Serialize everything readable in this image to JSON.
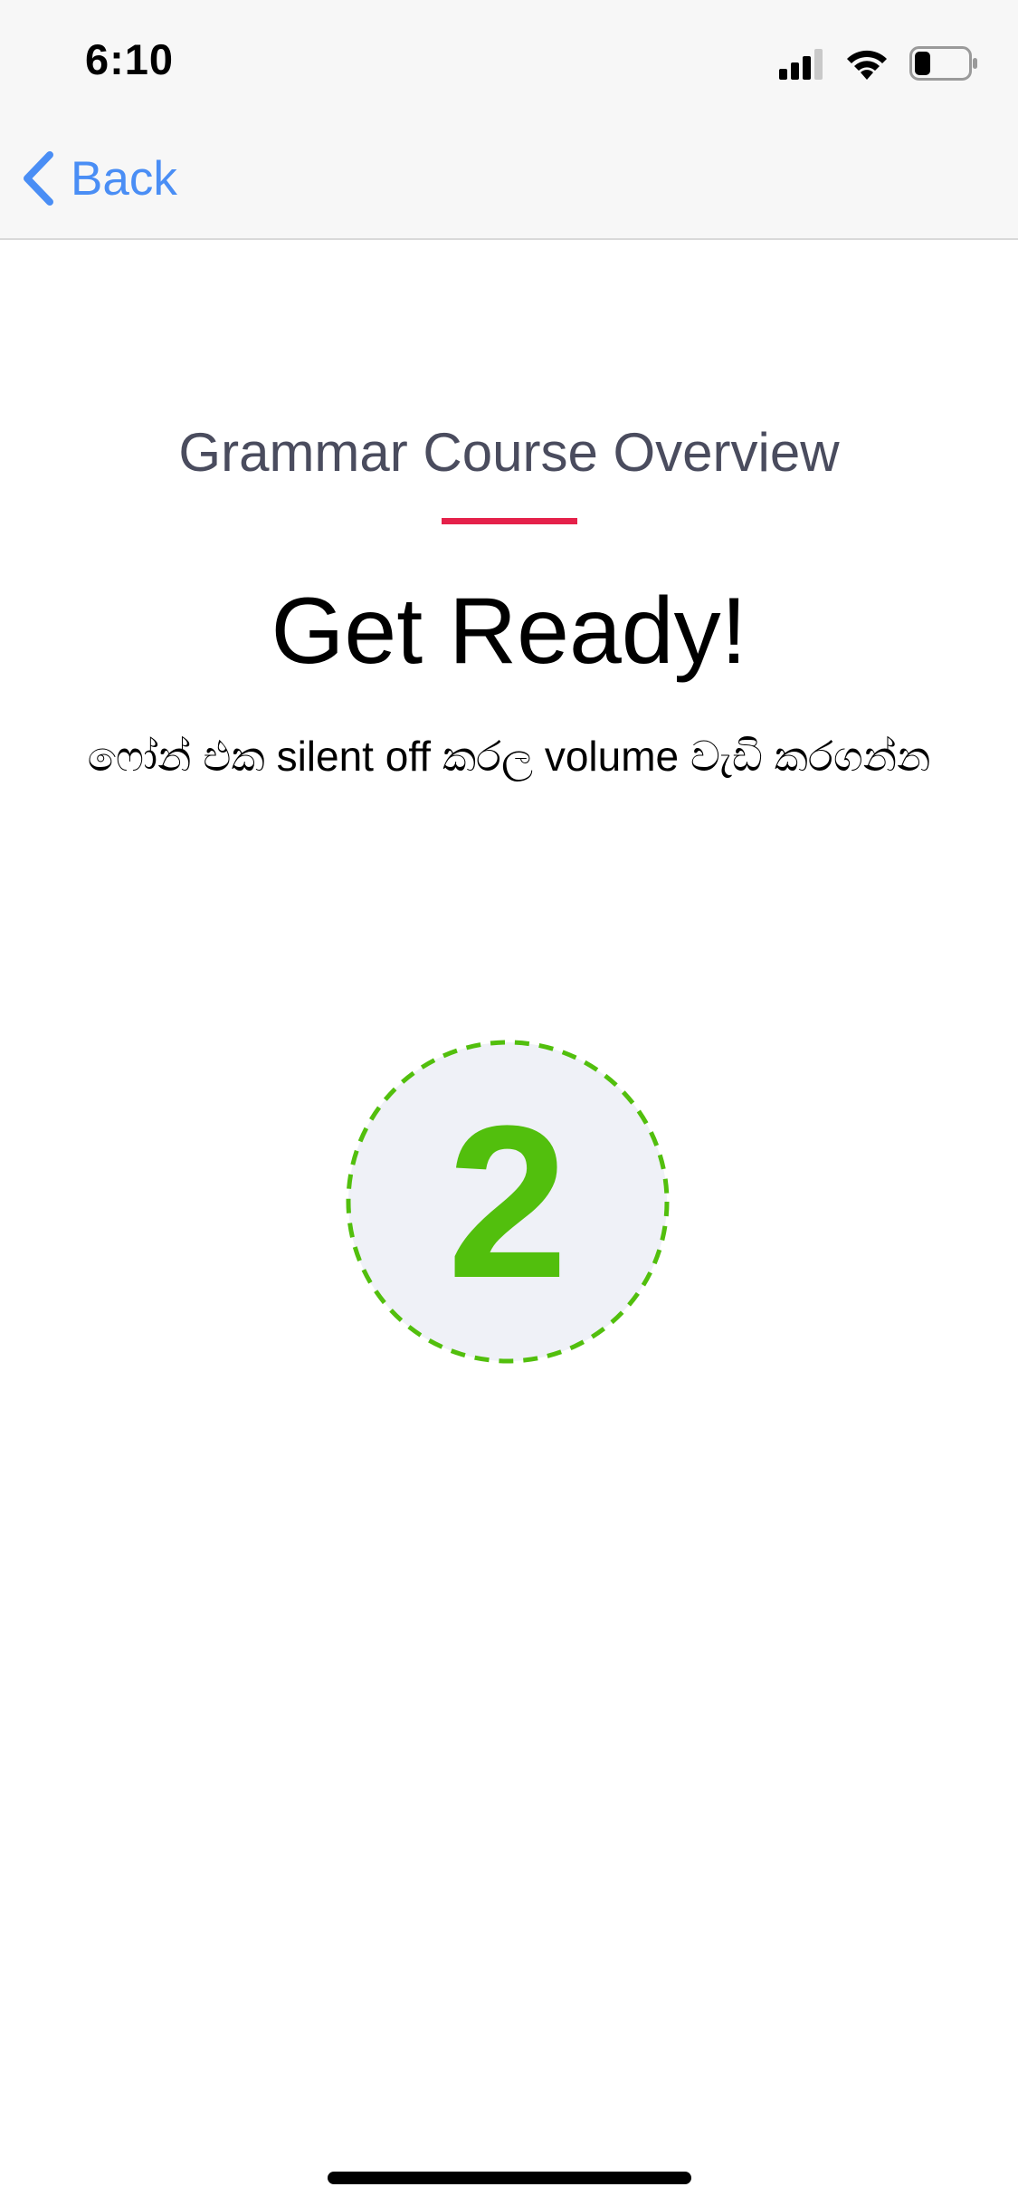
{
  "status_bar": {
    "time": "6:10",
    "signal_icon": "cellular-signal-icon",
    "wifi_icon": "wifi-icon",
    "battery_icon": "battery-icon",
    "battery_level": 0.3
  },
  "nav": {
    "back_label": "Back",
    "back_icon": "chevron-left-icon"
  },
  "content": {
    "subtitle": "Grammar Course Overview",
    "heading": "Get Ready!",
    "instruction": "ෆෝන් එක silent off කරල volume වැඩි කරගන්න"
  },
  "countdown": {
    "value": "2"
  },
  "colors": {
    "accent_blue": "#4a8ef5",
    "accent_red": "#e5214a",
    "countdown_green": "#52bf0d",
    "circle_fill": "#eff1f7"
  }
}
